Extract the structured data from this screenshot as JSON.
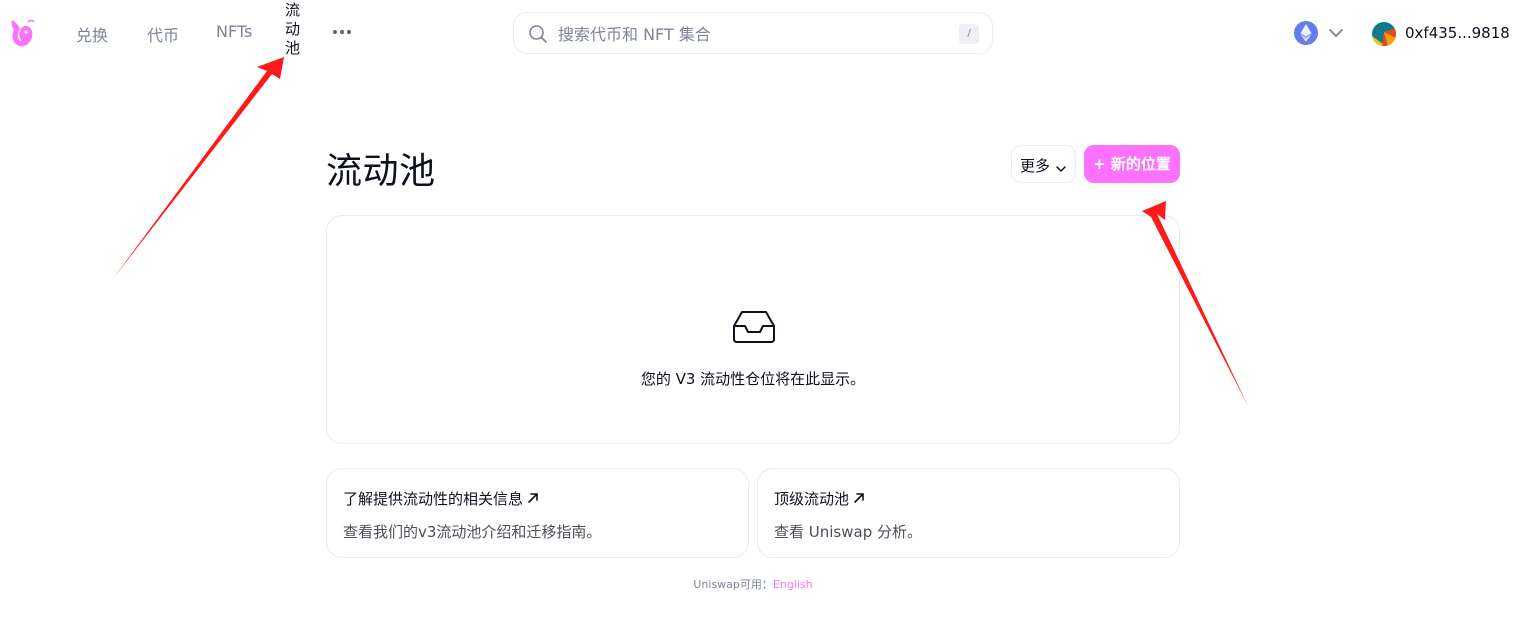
{
  "nav": {
    "items": [
      {
        "label": "兑换"
      },
      {
        "label": "代币"
      },
      {
        "label": "NFTs"
      },
      {
        "label": "流动池"
      }
    ],
    "more_icon": "ellipsis-icon"
  },
  "search": {
    "placeholder": "搜索代币和 NFT 集合",
    "shortcut": "/"
  },
  "chain": {
    "icon": "ethereum-icon"
  },
  "wallet": {
    "address": "0xf435...9818"
  },
  "page": {
    "title": "流动池",
    "more_label": "更多",
    "new_position_label": "+ 新的位置"
  },
  "empty_state": {
    "icon": "inbox-icon",
    "text": "您的 V3 流动性仓位将在此显示。"
  },
  "cards": [
    {
      "title": "了解提供流动性的相关信息",
      "desc": "查看我们的v3流动池介绍和迁移指南。"
    },
    {
      "title": "顶级流动池",
      "desc": "查看 Uniswap 分析。"
    }
  ],
  "footer": {
    "prefix": "Uniswap可用：",
    "link": "English"
  },
  "colors": {
    "accent": "#fc72ff",
    "annotation": "#ff1a1a",
    "text_primary": "#0d111c",
    "text_secondary": "#7d8593"
  }
}
